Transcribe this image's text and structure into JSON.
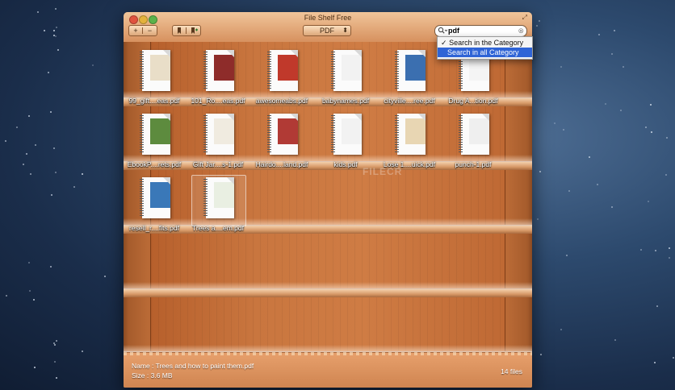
{
  "window": {
    "title": "File Shelf Free"
  },
  "toolbar": {
    "add_label": "+",
    "remove_label": "−",
    "category_label": "PDF",
    "category_arrows": "⬍"
  },
  "search": {
    "value": "pdf",
    "clear_icon": "⊗"
  },
  "search_menu": {
    "checkmark": "✓",
    "items": [
      {
        "label": "Search in the Category",
        "checked": true
      },
      {
        "label": "Search in all Category",
        "checked": false
      }
    ]
  },
  "shelves": [
    {
      "books": [
        {
          "label": "99_gift....eas.pdf",
          "cover": "#e9dec8"
        },
        {
          "label": "101_Ro....eas.pdf",
          "cover": "#8e2c2a"
        },
        {
          "label": "awesomeabs.pdf",
          "cover": "#c0392b"
        },
        {
          "label": "babynames.pdf",
          "cover": "#f2f2f2"
        },
        {
          "label": "cityville....ree.pdf",
          "cover": "#3b6fb0"
        },
        {
          "label": "Drug A...tion.pdf",
          "cover": "#f4f4f4"
        }
      ]
    },
    {
      "books": [
        {
          "label": "EbookP....rets.pdf",
          "cover": "#5d8b3e"
        },
        {
          "label": "Gift Jar....s-1.pdf",
          "cover": "#f0ebe0"
        },
        {
          "label": "Hairdo....land.pdf",
          "cover": "#b13a35"
        },
        {
          "label": "kids.pdf",
          "cover": "#f2f2f2"
        },
        {
          "label": "Lose 1....uick.pdf",
          "cover": "#e8d6b3"
        },
        {
          "label": "punch-1.pdf",
          "cover": "#efefef"
        }
      ]
    },
    {
      "books": [
        {
          "label": "resell_r....fits.pdf",
          "cover": "#3a78b8"
        },
        {
          "label": "Trees a....em.pdf",
          "cover": "#e9efe2",
          "selected": true
        }
      ]
    }
  ],
  "watermark": "FILECR",
  "status": {
    "name_label": "Name : Trees and how to paint them.pdf",
    "size_label": "Size  : 3.6 MB",
    "count_label": "14 files"
  }
}
